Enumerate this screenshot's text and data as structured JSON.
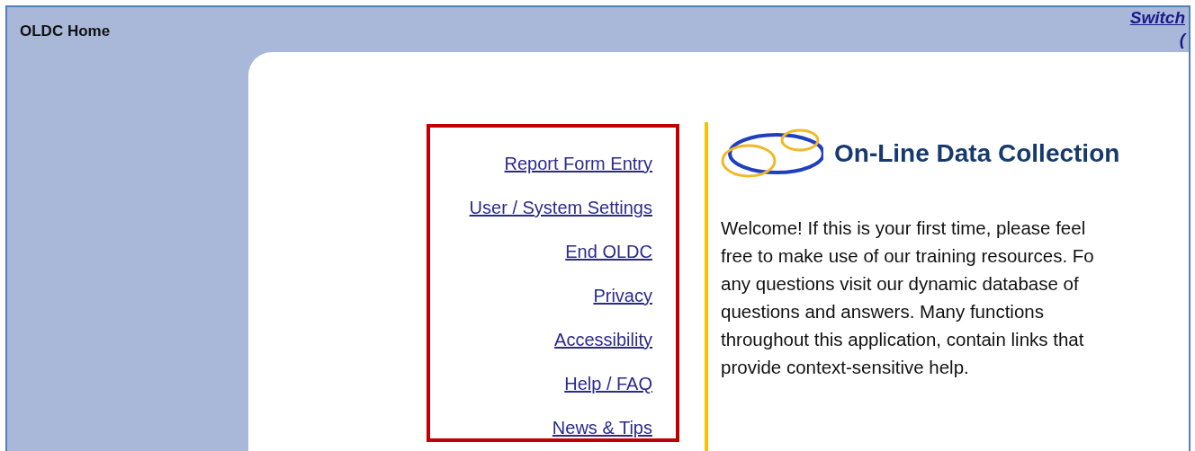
{
  "header": {
    "title": "OLDC Home",
    "switch_link": "Switch",
    "switch_link_line_2": "("
  },
  "nav_links": [
    {
      "label": "Report Form Entry"
    },
    {
      "label": "User / System Settings"
    },
    {
      "label": "End OLDC"
    },
    {
      "label": "Privacy"
    },
    {
      "label": "Accessibility"
    },
    {
      "label": "Help / FAQ"
    },
    {
      "label": "News & Tips"
    }
  ],
  "app_title": "On-Line Data Collection",
  "welcome_text": "Welcome! If this is your first time, please feel\nfree to make use of our training resources. Fo\nany questions visit our dynamic database of\nquestions and answers. Many functions\nthroughout this application, contain links that\nprovide context-sensitive help."
}
